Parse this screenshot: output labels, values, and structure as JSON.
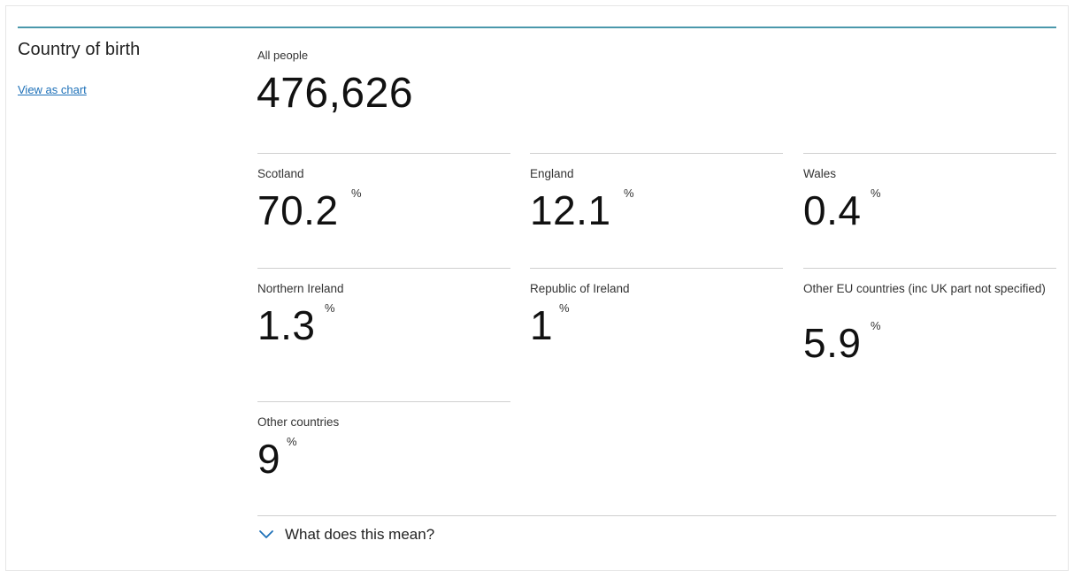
{
  "section": {
    "title": "Country of birth",
    "view_chart_link": "View as chart"
  },
  "total": {
    "label": "All people",
    "value": "476,626"
  },
  "stats": [
    {
      "label": "Scotland",
      "value": "70.2",
      "unit": "%"
    },
    {
      "label": "England",
      "value": "12.1",
      "unit": "%"
    },
    {
      "label": "Wales",
      "value": "0.4",
      "unit": "%"
    },
    {
      "label": "Northern Ireland",
      "value": "1.3",
      "unit": "%"
    },
    {
      "label": "Republic of Ireland",
      "value": "1",
      "unit": "%"
    },
    {
      "label": "Other EU countries (inc UK part not specified)",
      "value": "5.9",
      "unit": "%"
    },
    {
      "label": "Other countries",
      "value": "9",
      "unit": "%"
    }
  ],
  "explanation": {
    "toggle_label": "What does this mean?",
    "icon": "chevron-down-icon"
  },
  "colors": {
    "accent_rule": "#4a98ab",
    "link": "#1d70b8"
  }
}
